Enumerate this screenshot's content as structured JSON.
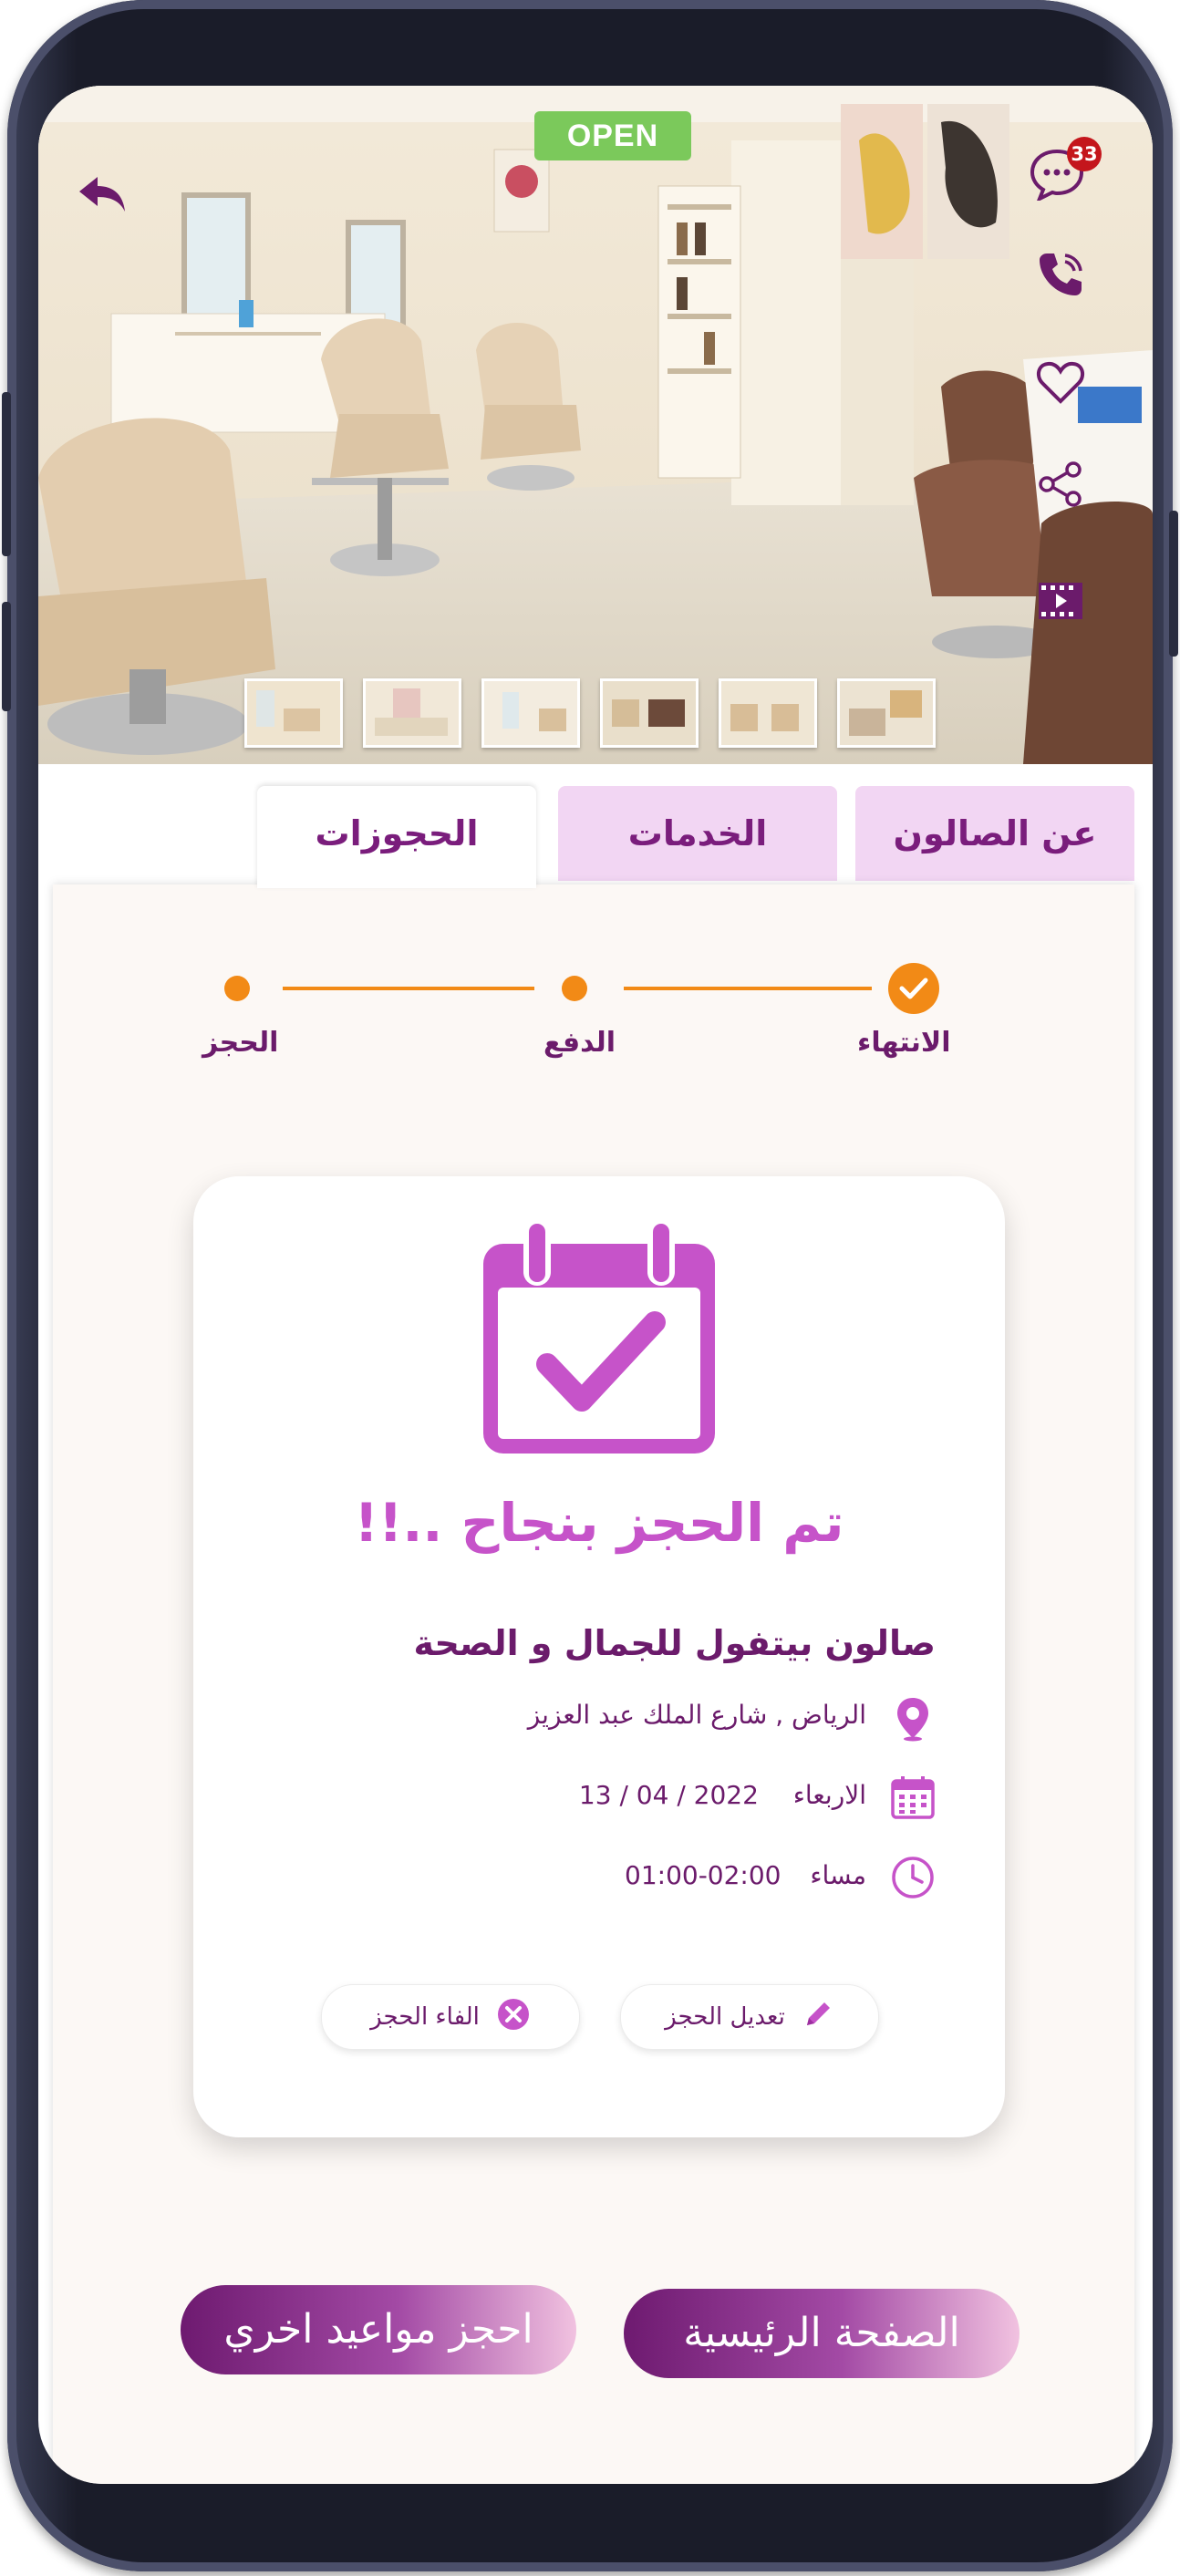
{
  "status_badge": "OPEN",
  "notifications_count": "33",
  "hero_icons": [
    "back-arrow-icon",
    "chat-icon",
    "phone-icon",
    "heart-icon",
    "share-icon",
    "video-icon"
  ],
  "tabs": [
    {
      "label": "عن الصالون"
    },
    {
      "label": "الخدمات"
    },
    {
      "label": "الحجوزات"
    }
  ],
  "steps": [
    {
      "label": "الانتهاء",
      "state": "done"
    },
    {
      "label": "الدفع",
      "state": "pending"
    },
    {
      "label": "الحجز",
      "state": "pending"
    }
  ],
  "booking": {
    "success_message": "تم الحجز بنجاح ..!!",
    "salon_name": "صالون بيتفول للجمال و الصحة",
    "address": "الرياض , شارع الملك عبد العزيز",
    "day": "الاربعاء",
    "date": "13 / 04 / 2022",
    "period": "مساء",
    "time": "01:00-02:00",
    "edit_label": "تعديل الحجز",
    "cancel_label": "الفاء الحجز"
  },
  "actions": {
    "home_label": "الصفحة الرئيسية",
    "book_more_label": "احجز مواعيد اخري"
  },
  "colors": {
    "accent_purple": "#6b1b6b",
    "magenta": "#c653c9",
    "orange": "#f28a16",
    "open_green": "#7bc95b",
    "tab_pink": "#f2d6f3"
  }
}
